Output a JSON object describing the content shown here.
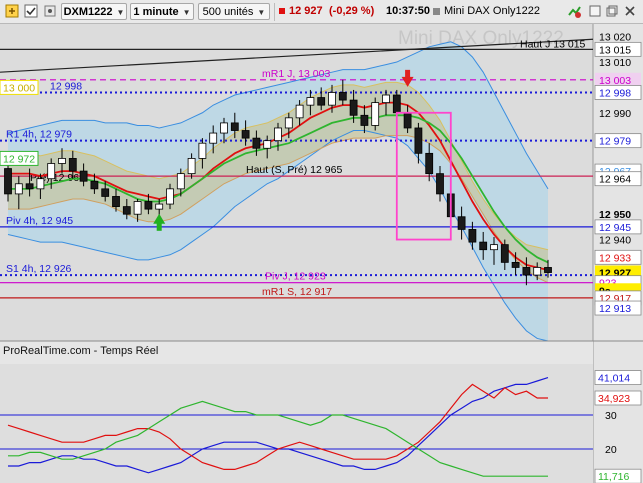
{
  "toolbar": {
    "instrument": "DXM1222",
    "timeframe": "1 minute",
    "units": "500 unités",
    "price": "12 927",
    "change": "(-0,29 %)",
    "time": "10:37:50",
    "name": "Mini DAX Only1222",
    "icons": [
      "link-icon",
      "checkbox-icon",
      "tool-icon",
      "expand-icon",
      "contract-icon",
      "close-icon",
      "chart-settings-icon",
      "refresh-icon"
    ]
  },
  "colors": {
    "background": "#dcdcdc",
    "bollinger_fill": "#b9d7e6",
    "bollinger_line": "#3a8ee0",
    "keltner_fill": "#c7c49a",
    "ma_red": "#e01010",
    "ma_green": "#2fb52f",
    "pivot_blue": "#1a1ad8",
    "resistance_magenta": "#cc00cc",
    "support_red": "#c01818",
    "box": "#ff44cc",
    "down_arrow": "#e02020",
    "up_arrow": "#20b020"
  },
  "chart_data": [
    {
      "type": "candlestick",
      "title": "Mini DAX Only1222",
      "ylim": [
        12900,
        13025
      ],
      "y_ticks": [
        13020,
        13010,
        12990,
        12940
      ],
      "candles": [
        [
          12968,
          12973,
          12955,
          12958
        ],
        [
          12958,
          12965,
          12952,
          12962
        ],
        [
          12962,
          12968,
          12957,
          12960
        ],
        [
          12960,
          12966,
          12956,
          12964
        ],
        [
          12964,
          12972,
          12960,
          12970
        ],
        [
          12970,
          12976,
          12966,
          12972
        ],
        [
          12972,
          12975,
          12964,
          12967
        ],
        [
          12967,
          12970,
          12961,
          12963
        ],
        [
          12963,
          12966,
          12958,
          12960
        ],
        [
          12960,
          12963,
          12955,
          12957
        ],
        [
          12957,
          12960,
          12951,
          12953
        ],
        [
          12953,
          12956,
          12948,
          12950
        ],
        [
          12950,
          12956,
          12947,
          12955
        ],
        [
          12955,
          12958,
          12950,
          12952
        ],
        [
          12952,
          12956,
          12949,
          12954
        ],
        [
          12954,
          12962,
          12952,
          12960
        ],
        [
          12960,
          12968,
          12957,
          12966
        ],
        [
          12966,
          12974,
          12964,
          12972
        ],
        [
          12972,
          12980,
          12968,
          12978
        ],
        [
          12978,
          12985,
          12974,
          12982
        ],
        [
          12982,
          12988,
          12978,
          12986
        ],
        [
          12986,
          12990,
          12980,
          12983
        ],
        [
          12983,
          12987,
          12977,
          12980
        ],
        [
          12980,
          12983,
          12973,
          12976
        ],
        [
          12976,
          12981,
          12972,
          12979
        ],
        [
          12979,
          12986,
          12975,
          12984
        ],
        [
          12984,
          12990,
          12980,
          12988
        ],
        [
          12988,
          12995,
          12985,
          12993
        ],
        [
          12993,
          12999,
          12989,
          12996
        ],
        [
          12996,
          13000,
          12991,
          12993
        ],
        [
          12993,
          13001,
          12990,
          12998
        ],
        [
          12998,
          13003,
          12993,
          12995
        ],
        [
          12995,
          12999,
          12986,
          12989
        ],
        [
          12989,
          12993,
          12982,
          12985
        ],
        [
          12985,
          12996,
          12983,
          12994
        ],
        [
          12994,
          12999,
          12989,
          12997
        ],
        [
          12997,
          12999,
          12988,
          12990
        ],
        [
          12990,
          12993,
          12982,
          12984
        ],
        [
          12984,
          12986,
          12970,
          12974
        ],
        [
          12974,
          12978,
          12963,
          12966
        ],
        [
          12966,
          12969,
          12955,
          12958
        ],
        [
          12958,
          12962,
          12946,
          12949
        ],
        [
          12949,
          12953,
          12940,
          12944
        ],
        [
          12944,
          12947,
          12936,
          12939
        ],
        [
          12939,
          12943,
          12932,
          12936
        ],
        [
          12936,
          12941,
          12930,
          12938
        ],
        [
          12938,
          12940,
          12928,
          12931
        ],
        [
          12931,
          12935,
          12926,
          12929
        ],
        [
          12929,
          12933,
          12922,
          12926
        ],
        [
          12926,
          12931,
          12924,
          12929
        ],
        [
          12929,
          12932,
          12925,
          12927
        ]
      ],
      "bollinger": {
        "upper": [
          12982,
          12983,
          12984,
          12985,
          12986,
          12987,
          12987,
          12987,
          12987,
          12986,
          12986,
          12986,
          12985,
          12985,
          12984,
          12985,
          12986,
          12988,
          12990,
          12993,
          12995,
          12997,
          12998,
          12999,
          13000,
          13001,
          13002,
          13003,
          13004,
          13005,
          13006,
          13007,
          13007,
          13007,
          13008,
          13009,
          13010,
          13012,
          13014,
          13016,
          13017,
          13018,
          13016,
          13012,
          13006,
          12998,
          12990,
          12982,
          12974,
          12967,
          12960
        ],
        "middle": [
          12962,
          12962,
          12962,
          12962,
          12963,
          12963,
          12963,
          12962,
          12962,
          12961,
          12960,
          12959,
          12958,
          12958,
          12958,
          12959,
          12961,
          12963,
          12966,
          12969,
          12972,
          12975,
          12977,
          12979,
          12981,
          12983,
          12985,
          12987,
          12989,
          12991,
          12993,
          12994,
          12995,
          12995,
          12995,
          12995,
          12995,
          12994,
          12993,
          12991,
          12988,
          12985,
          12981,
          12976,
          12971,
          12966,
          12961,
          12956,
          12951,
          12946,
          12942
        ],
        "lower": [
          12942,
          12941,
          12940,
          12939,
          12939,
          12939,
          12938,
          12937,
          12936,
          12935,
          12934,
          12933,
          12932,
          12932,
          12933,
          12934,
          12936,
          12939,
          12942,
          12945,
          12949,
          12953,
          12956,
          12959,
          12962,
          12964,
          12967,
          12970,
          12973,
          12976,
          12979,
          12981,
          12983,
          12983,
          12982,
          12981,
          12980,
          12977,
          12972,
          12967,
          12960,
          12952,
          12945,
          12937,
          12929,
          12922,
          12915,
          12909,
          12904,
          12901,
          12900
        ]
      },
      "ma_red": [
        12966,
        12966,
        12966,
        12965,
        12966,
        12967,
        12967,
        12966,
        12965,
        12963,
        12961,
        12959,
        12958,
        12957,
        12956,
        12957,
        12958,
        12961,
        12964,
        12968,
        12971,
        12974,
        12976,
        12977,
        12978,
        12980,
        12982,
        12985,
        12988,
        12990,
        12992,
        12993,
        12993,
        12992,
        12993,
        12994,
        12994,
        12993,
        12990,
        12985,
        12979,
        12971,
        12963,
        12955,
        12948,
        12942,
        12937,
        12933,
        12930,
        12929,
        12928
      ],
      "ma_green": [
        12960,
        12960,
        12960,
        12961,
        12962,
        12963,
        12964,
        12964,
        12963,
        12962,
        12960,
        12958,
        12956,
        12955,
        12955,
        12956,
        12958,
        12961,
        12964,
        12967,
        12970,
        12972,
        12974,
        12975,
        12976,
        12977,
        12978,
        12980,
        12982,
        12984,
        12986,
        12987,
        12988,
        12988,
        12988,
        12989,
        12989,
        12989,
        12988,
        12986,
        12983,
        12978,
        12972,
        12965,
        12958,
        12951,
        12945,
        12940,
        12936,
        12933,
        12931
      ],
      "hlines": [
        {
          "label": "Haut J 13 015",
          "value": 13015,
          "color": "#222222",
          "style": "solid"
        },
        {
          "label": "mR1 J, 13 003",
          "value": 13003,
          "color": "#cc00cc",
          "style": "dashed"
        },
        {
          "label": "12 998",
          "value": 12998,
          "color": "#1a1ad8",
          "style": "dotted"
        },
        {
          "label": "R1 4h, 12 979",
          "value": 12979,
          "color": "#1a1ad8",
          "style": "dotted"
        },
        {
          "label": "Haut (S, Pré) 12 965",
          "value": 12965,
          "color": "#cc2255",
          "style": "solid"
        },
        {
          "label": "Piv 4h, 12 945",
          "value": 12945,
          "color": "#1a1ad8",
          "style": "solid"
        },
        {
          "label": "S1 4h, 12 926",
          "value": 12926,
          "color": "#1a1ad8",
          "style": "dotted"
        },
        {
          "label": "Piv J, 12 923",
          "value": 12923,
          "color": "#cc00cc",
          "style": "solid"
        },
        {
          "label": "mR1 S, 12 917",
          "value": 12917,
          "color": "#c01818",
          "style": "solid"
        }
      ],
      "right_labels": [
        {
          "text": "13 020",
          "value": 13020,
          "bg": "",
          "fg": "#000000"
        },
        {
          "text": "13 015",
          "value": 13015,
          "bg": "#ffffff",
          "fg": "#000000"
        },
        {
          "text": "13 010",
          "value": 13010,
          "bg": "",
          "fg": "#000000"
        },
        {
          "text": "13 003",
          "value": 13003,
          "bg": "#f0d0f0",
          "fg": "#cc00cc"
        },
        {
          "text": "12 998",
          "value": 12998,
          "bg": "#ffffff",
          "fg": "#1a1ad8"
        },
        {
          "text": "12 990",
          "value": 12990,
          "bg": "",
          "fg": "#000000"
        },
        {
          "text": "12 979",
          "value": 12979,
          "bg": "#ffffff",
          "fg": "#1a1ad8"
        },
        {
          "text": "12 967",
          "value": 12967,
          "bg": "#ffffff",
          "fg": "#3a8ee0"
        },
        {
          "text": "12 965",
          "value": 12965,
          "bg": "",
          "fg": "#000000"
        },
        {
          "text": "12 964",
          "value": 12964,
          "bg": "#ffffff",
          "fg": "#000000"
        },
        {
          "text": "12 950",
          "value": 12950,
          "bg": "",
          "fg": "#000000"
        },
        {
          "text": "12 945",
          "value": 12945,
          "bg": "#ffffff",
          "fg": "#1a1ad8"
        },
        {
          "text": "12 940",
          "value": 12940,
          "bg": "",
          "fg": "#000000"
        },
        {
          "text": "12 933",
          "value": 12933,
          "bg": "#ffffff",
          "fg": "#e01010"
        },
        {
          "text": "12 927",
          "value": 12927,
          "bg": "#ffee00",
          "fg": "#000000"
        },
        {
          "text": "923",
          "value": 12923,
          "bg": "#ffffff",
          "fg": "#cc00cc"
        },
        {
          "text": "9s",
          "value": 12920,
          "bg": "#ffee00",
          "fg": "#000000"
        },
        {
          "text": "12 917",
          "value": 12917,
          "bg": "#ffffff",
          "fg": "#c01818"
        },
        {
          "text": "12 913",
          "value": 12913,
          "bg": "#ffffff",
          "fg": "#1a1ad8"
        }
      ],
      "left_labels": [
        {
          "text": "13 000",
          "value": 13000,
          "color": "#f0e000"
        },
        {
          "text": "12 972",
          "value": 12972,
          "color": "#2fb52f"
        }
      ],
      "extra_texts": [
        "Pré) 12 96",
        "S, Pré) 12 957 00"
      ],
      "markers": [
        {
          "type": "down-arrow",
          "x_index": 37,
          "value": 13001
        },
        {
          "type": "up-arrow",
          "x_index": 14,
          "value": 12947
        }
      ],
      "box": {
        "x_start": 36,
        "x_end": 41,
        "y_top": 12990,
        "y_bottom": 12940
      }
    },
    {
      "type": "line",
      "title": "ProRealTime.com - Temps Réel",
      "ylim": [
        10,
        45
      ],
      "y_ticks": [
        30,
        20
      ],
      "hlines": [
        30,
        20
      ],
      "series": [
        {
          "name": "",
          "color": "#1a1ad8",
          "last_label": "41,014",
          "values": [
            15,
            15,
            16,
            16,
            17,
            18,
            18,
            17,
            17,
            16,
            15,
            15,
            14,
            13,
            14,
            15,
            16,
            18,
            20,
            21,
            22,
            22,
            22,
            22,
            21,
            20,
            20,
            19,
            18,
            17,
            16,
            15,
            15,
            14,
            14,
            15,
            16,
            18,
            21,
            24,
            27,
            30,
            32,
            34,
            35,
            37,
            38,
            39,
            39,
            40,
            41
          ]
        },
        {
          "name": "",
          "color": "#e01010",
          "last_label": "34,923",
          "values": [
            27,
            26,
            25,
            24,
            23,
            22,
            22,
            22,
            23,
            24,
            24,
            25,
            26,
            26,
            25,
            23,
            20,
            18,
            16,
            15,
            14,
            14,
            15,
            16,
            18,
            20,
            21,
            22,
            21,
            20,
            19,
            18,
            17,
            17,
            17,
            17,
            18,
            20,
            22,
            25,
            28,
            32,
            36,
            39,
            37,
            35,
            38,
            36,
            37,
            35,
            35
          ]
        },
        {
          "name": "",
          "color": "#2fb52f",
          "last_label": "11,716",
          "values": [
            18,
            18,
            19,
            19,
            18,
            17,
            17,
            18,
            19,
            20,
            22,
            23,
            24,
            26,
            28,
            30,
            32,
            33,
            34,
            33,
            32,
            31,
            31,
            30,
            30,
            30,
            29,
            28,
            27,
            28,
            30,
            30,
            29,
            28,
            27,
            26,
            24,
            22,
            20,
            18,
            16,
            15,
            14,
            13,
            12,
            12,
            12,
            12,
            12,
            12,
            12
          ]
        }
      ]
    }
  ],
  "watermark": "Mini DAX Only1222",
  "panel_title": "ProRealTime.com - Temps Réel"
}
